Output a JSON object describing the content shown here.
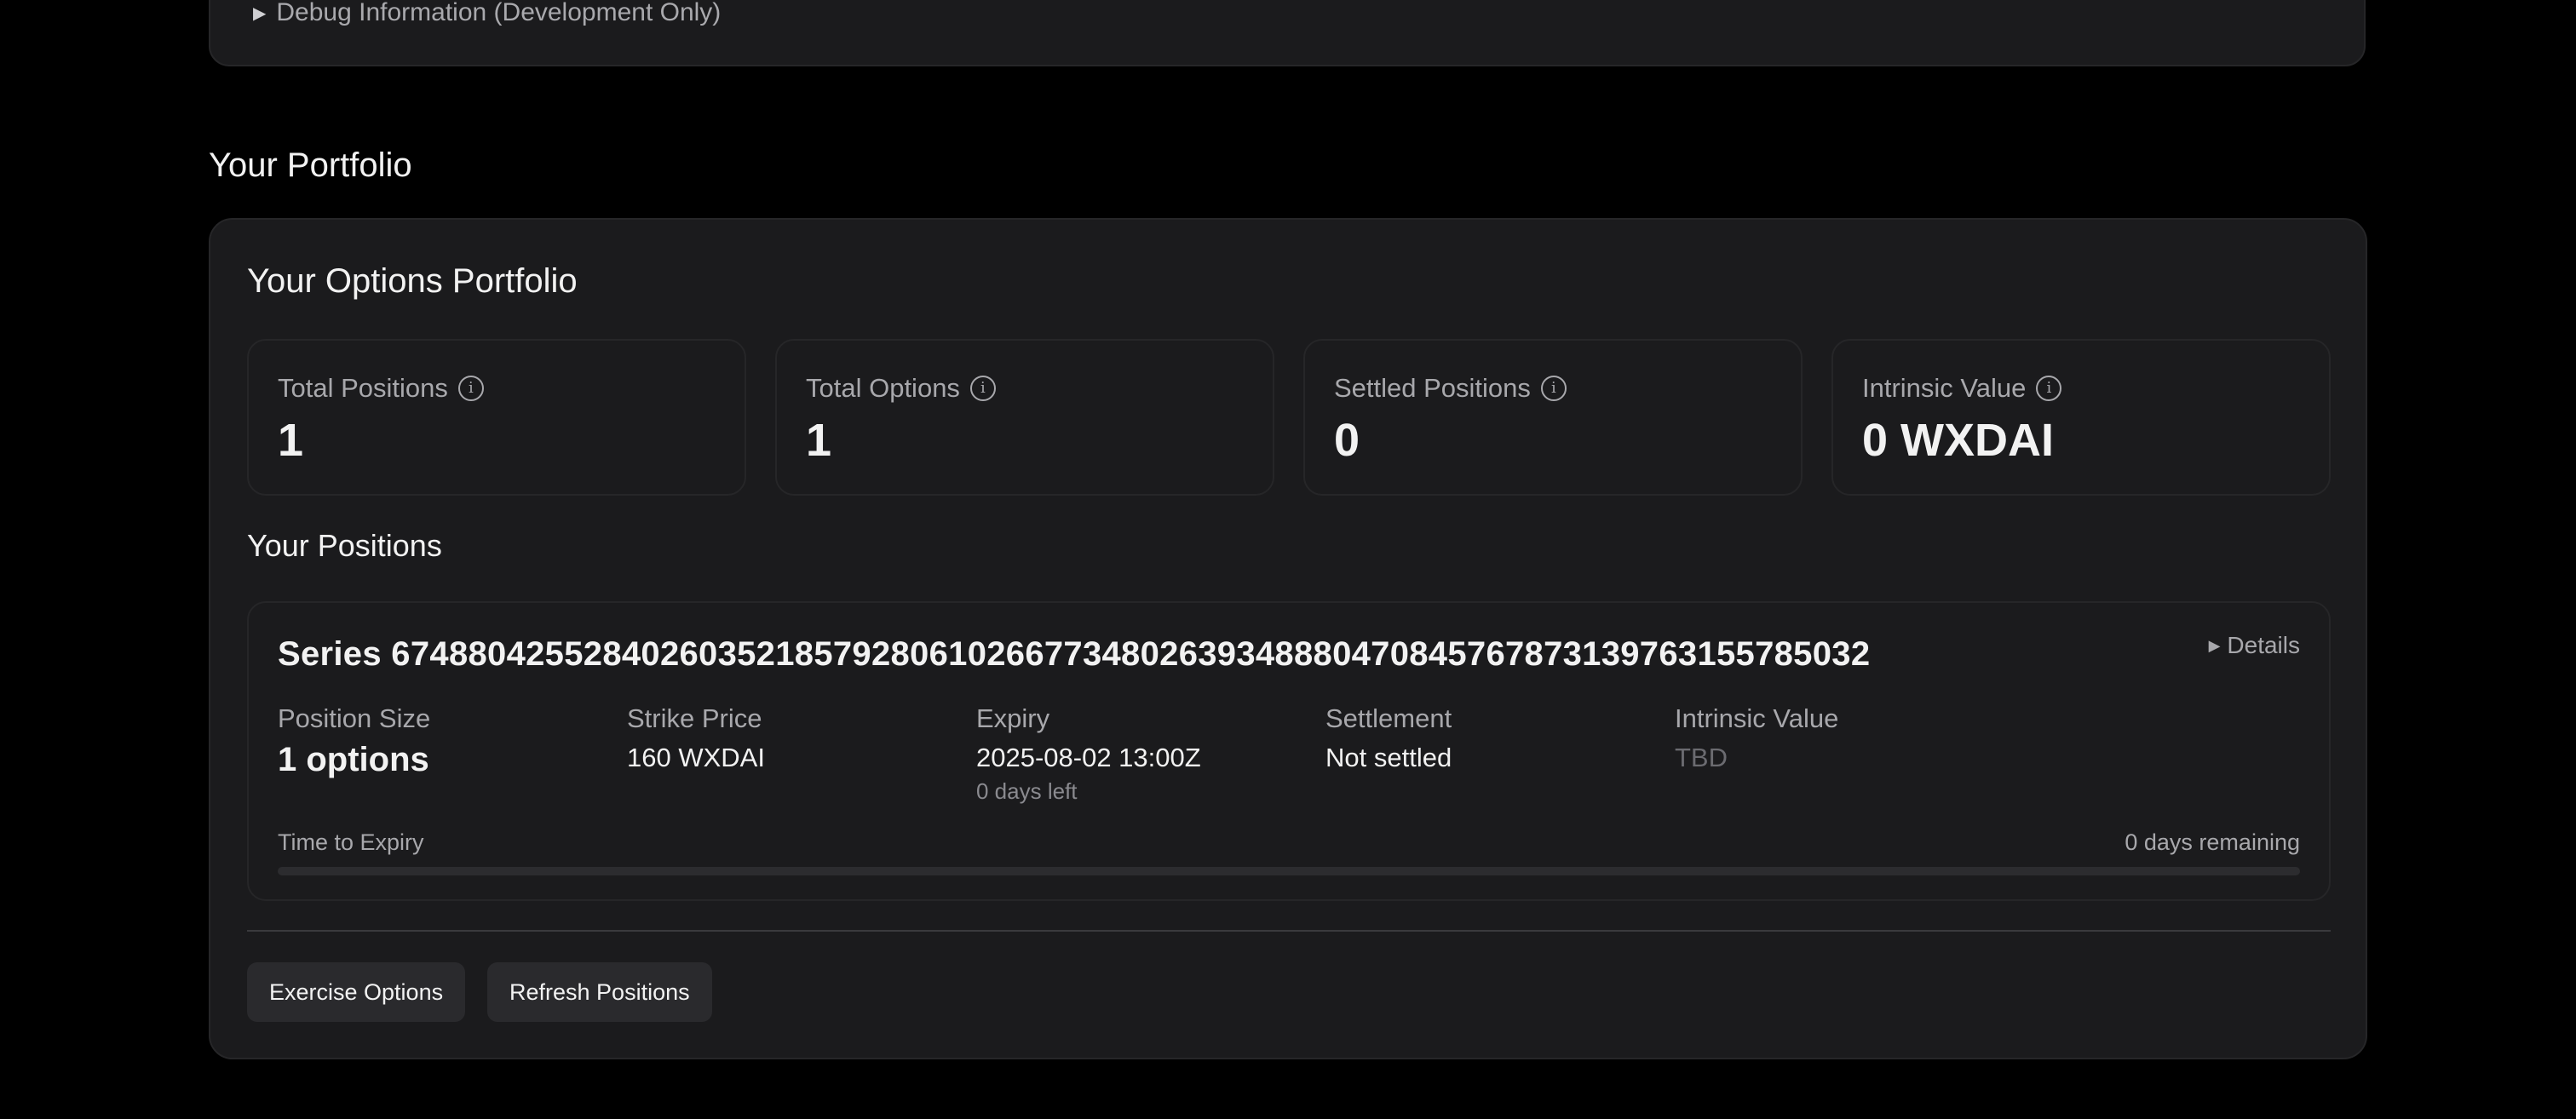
{
  "debug": {
    "summary": "Debug Information (Development Only)"
  },
  "portfolio_section": {
    "title": "Your Portfolio",
    "card_title": "Your Options Portfolio",
    "stats": [
      {
        "label": "Total Positions",
        "value": "1"
      },
      {
        "label": "Total Options",
        "value": "1"
      },
      {
        "label": "Settled Positions",
        "value": "0"
      },
      {
        "label": "Intrinsic Value",
        "value": "0 WXDAI"
      }
    ],
    "positions_title": "Your Positions",
    "position": {
      "series_title": "Series 67488042552840260352185792806102667734802639348880470845767873139763155785032",
      "details_label": "Details",
      "fields": {
        "position_size": {
          "label": "Position Size",
          "value": "1 options"
        },
        "strike_price": {
          "label": "Strike Price",
          "value": "160 WXDAI"
        },
        "expiry": {
          "label": "Expiry",
          "value": "2025-08-02 13:00Z",
          "sub": "0 days left"
        },
        "settlement": {
          "label": "Settlement",
          "value": "Not settled"
        },
        "intrinsic_value": {
          "label": "Intrinsic Value",
          "value": "TBD"
        }
      },
      "time_to_expiry_label": "Time to Expiry",
      "time_remaining_label": "0 days remaining",
      "time_elapsed_fraction": 0
    },
    "buttons": {
      "exercise": "Exercise Options",
      "refresh": "Refresh Positions"
    }
  },
  "icons": {
    "info": "info-icon",
    "disclosure": "triangle-right-icon"
  },
  "colors": {
    "background": "#000000",
    "card": "#1b1b1d",
    "border": "#262628",
    "text": "#f2f2f2",
    "muted_text": "#a8a8ac"
  }
}
